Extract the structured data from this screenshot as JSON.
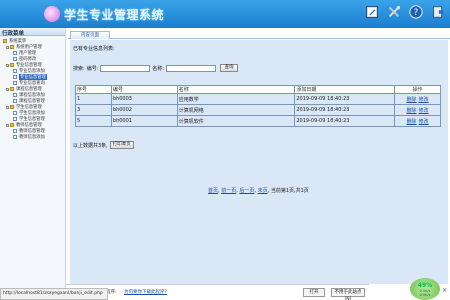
{
  "header": {
    "app_title": "学生专业管理系统",
    "icons": [
      "edit-icon",
      "tools-icon",
      "help-icon",
      "exit-icon"
    ],
    "colors": {
      "accent": "#1a7ed0",
      "panel": "#d9e7f6"
    }
  },
  "sidebar": {
    "title": "行政菜单",
    "items": [
      {
        "label": "系统菜单",
        "level": 0,
        "type": "folder"
      },
      {
        "label": "系统用户管理",
        "level": 1,
        "type": "folder"
      },
      {
        "label": "用户管理",
        "level": 2,
        "type": "leaf"
      },
      {
        "label": "密码修改",
        "level": 2,
        "type": "leaf"
      },
      {
        "label": "专业信息管理",
        "level": 1,
        "type": "folder"
      },
      {
        "label": "专业信息添加",
        "level": 2,
        "type": "leaf"
      },
      {
        "label": "专业信息管理",
        "level": 2,
        "type": "leaf",
        "selected": true
      },
      {
        "label": "专业信息查询",
        "level": 2,
        "type": "leaf"
      },
      {
        "label": "课程信息管理",
        "level": 1,
        "type": "folder"
      },
      {
        "label": "课程信息添加",
        "level": 2,
        "type": "leaf"
      },
      {
        "label": "课程信息管理",
        "level": 2,
        "type": "leaf"
      },
      {
        "label": "学生信息管理",
        "level": 1,
        "type": "folder"
      },
      {
        "label": "学生信息添加",
        "level": 2,
        "type": "leaf"
      },
      {
        "label": "学生信息管理",
        "level": 2,
        "type": "leaf"
      },
      {
        "label": "教师信息管理",
        "level": 1,
        "type": "folder"
      },
      {
        "label": "教师信息管理",
        "level": 2,
        "type": "leaf"
      },
      {
        "label": "教师信息添加",
        "level": 2,
        "type": "leaf"
      }
    ]
  },
  "main": {
    "tab_label": "内容页面",
    "panel_title": "已有专业信息列表:",
    "search": {
      "label_prefix": "搜索:",
      "code_label": "编号:",
      "name_label": "名称:",
      "code_value": "",
      "name_value": "",
      "button_label": "查询"
    },
    "table": {
      "headers": [
        "序号",
        "编号",
        "名称",
        "添加日期",
        "操作"
      ],
      "rows": [
        {
          "seq": "1",
          "code": "bh0003",
          "name": "应用数学",
          "date": "2019-09-09 18:40:23",
          "op1": "删除",
          "op2": "修改"
        },
        {
          "seq": "3",
          "code": "bh0002",
          "name": "计算机网络",
          "date": "2019-09-09 18:40:23",
          "op1": "删除",
          "op2": "修改"
        },
        {
          "seq": "5",
          "code": "bh0001",
          "name": "计算机软件",
          "date": "2019-09-09 18:40:23",
          "op1": "删除",
          "op2": "修改"
        }
      ]
    },
    "summary": {
      "text": "以上数据共3条,",
      "print_button": "打印本页"
    },
    "pager": {
      "first": "首页",
      "prev": "前一页",
      "next": "后一页",
      "last": "末页",
      "sep": ",",
      "status": "当前第1页,共1页"
    }
  },
  "download_bar": {
    "text": "localhost 的程序:",
    "link": "为何要你下载此程序?",
    "open_button": "打开",
    "never_button": "不用于此站点(N)"
  },
  "status_bar": {
    "url": "http://localhost81/zsxyegxanl/banji_edit.php"
  },
  "net_widget": {
    "percent": "49%",
    "line1": "0.0K/s",
    "line2": "0.0K/s"
  }
}
